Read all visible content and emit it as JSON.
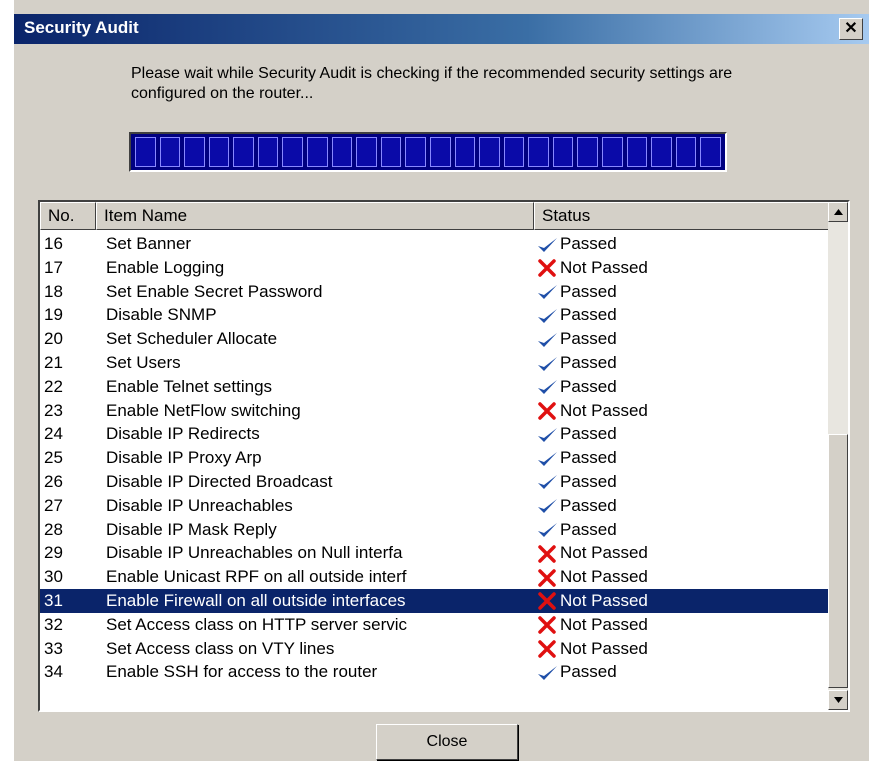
{
  "window": {
    "title": "Security Audit",
    "close_glyph": "✕"
  },
  "message": "Please wait while Security Audit is checking if the recommended security settings are configured on the router...",
  "progress": {
    "fraction": 1.0,
    "segments": 24
  },
  "columns": {
    "no": "No.",
    "name": "Item Name",
    "status": "Status"
  },
  "rows": [
    {
      "no": "16",
      "name": "Set Banner",
      "status": "Passed",
      "icon": "check-icon"
    },
    {
      "no": "17",
      "name": "Enable Logging",
      "status": "Not Passed",
      "icon": "x-icon"
    },
    {
      "no": "18",
      "name": "Set Enable Secret Password",
      "status": "Passed",
      "icon": "check-icon"
    },
    {
      "no": "19",
      "name": "Disable SNMP",
      "status": "Passed",
      "icon": "check-icon"
    },
    {
      "no": "20",
      "name": "Set Scheduler Allocate",
      "status": "Passed",
      "icon": "check-icon"
    },
    {
      "no": "21",
      "name": "Set Users",
      "status": "Passed",
      "icon": "check-icon"
    },
    {
      "no": "22",
      "name": "Enable Telnet settings",
      "status": "Passed",
      "icon": "check-icon"
    },
    {
      "no": "23",
      "name": "Enable NetFlow switching",
      "status": "Not Passed",
      "icon": "x-icon"
    },
    {
      "no": "24",
      "name": "Disable IP Redirects",
      "status": "Passed",
      "icon": "check-icon"
    },
    {
      "no": "25",
      "name": "Disable IP Proxy Arp",
      "status": "Passed",
      "icon": "check-icon"
    },
    {
      "no": "26",
      "name": "Disable IP Directed Broadcast",
      "status": "Passed",
      "icon": "check-icon"
    },
    {
      "no": "27",
      "name": "Disable IP Unreachables",
      "status": "Passed",
      "icon": "check-icon"
    },
    {
      "no": "28",
      "name": "Disable IP Mask Reply",
      "status": "Passed",
      "icon": "check-icon"
    },
    {
      "no": "29",
      "name": "Disable IP Unreachables on Null interfa",
      "status": "Not Passed",
      "icon": "x-icon"
    },
    {
      "no": "30",
      "name": "Enable Unicast RPF on all outside interf",
      "status": "Not Passed",
      "icon": "x-icon"
    },
    {
      "no": "31",
      "name": "Enable Firewall on all outside interfaces",
      "status": "Not Passed",
      "icon": "x-icon",
      "selected": true
    },
    {
      "no": "32",
      "name": "Set Access class on HTTP server servic",
      "status": "Not Passed",
      "icon": "x-icon"
    },
    {
      "no": "33",
      "name": "Set Access class on VTY lines",
      "status": "Not Passed",
      "icon": "x-icon"
    },
    {
      "no": "34",
      "name": "Enable SSH for access to the router",
      "status": "Passed",
      "icon": "check-icon"
    }
  ],
  "buttons": {
    "close": "Close"
  },
  "colors": {
    "title_bar": "#0a246a",
    "selection": "#0a246a",
    "progress": "#000080",
    "passed": "#1f4fa8",
    "not_passed": "#e01010",
    "dialog_bg": "#d4d0c8"
  }
}
